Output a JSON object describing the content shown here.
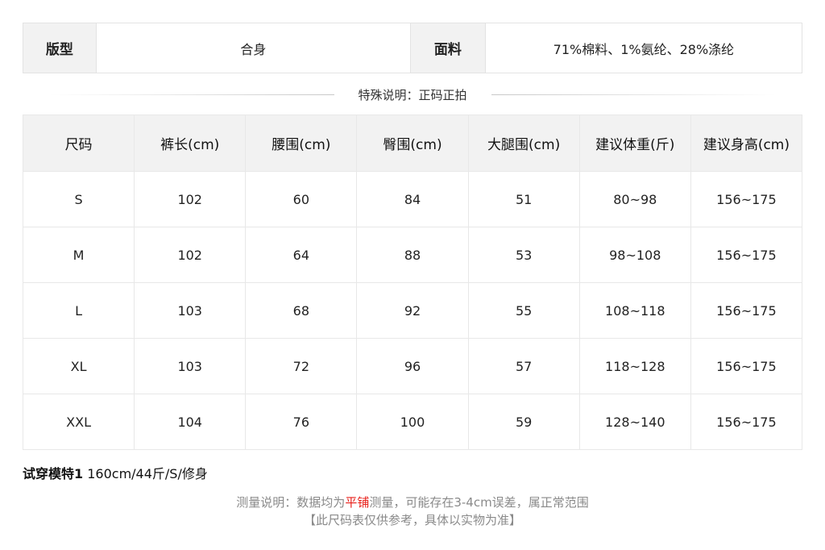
{
  "info": {
    "fit_label": "版型",
    "fit_value": "合身",
    "fabric_label": "面料",
    "fabric_value": "71%棉料、1%氨纶、28%涤纶"
  },
  "special_note": "特殊说明：正码正拍",
  "size_table": {
    "headers": [
      "尺码",
      "裤长(cm)",
      "腰围(cm)",
      "臀围(cm)",
      "大腿围(cm)",
      "建议体重(斤)",
      "建议身高(cm)"
    ],
    "rows": [
      [
        "S",
        "102",
        "60",
        "84",
        "51",
        "80~98",
        "156~175"
      ],
      [
        "M",
        "102",
        "64",
        "88",
        "53",
        "98~108",
        "156~175"
      ],
      [
        "L",
        "103",
        "68",
        "92",
        "55",
        "108~118",
        "156~175"
      ],
      [
        "XL",
        "103",
        "72",
        "96",
        "57",
        "118~128",
        "156~175"
      ],
      [
        "XXL",
        "104",
        "76",
        "100",
        "59",
        "128~140",
        "156~175"
      ]
    ]
  },
  "model": {
    "label": "试穿模特1",
    "value": "160cm/44斤/S/修身"
  },
  "footer": {
    "line1_prefix": "测量说明：数据均为",
    "line1_highlight": "平铺",
    "line1_suffix": "测量，可能存在3-4cm误差，属正常范围",
    "line2": "【此尺码表仅供参考，具体以实物为准】"
  },
  "colors": {
    "header_bg": "#f2f2f2",
    "highlight": "#e8211b",
    "footer_text": "#8a8a8a"
  }
}
